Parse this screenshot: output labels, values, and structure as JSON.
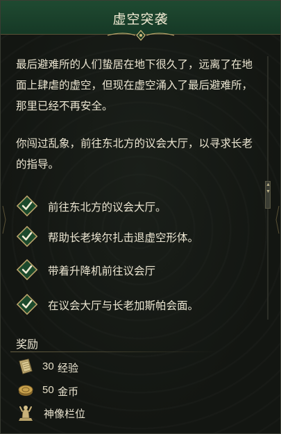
{
  "quest": {
    "title": "虚空突袭",
    "description": [
      "最后避难所的人们蛰居在地下很久了，远离了在地面上肆虐的虚空，但现在虚空涌入了最后避难所，那里已经不再安全。",
      "你闯过乱象，前往东北方的议会大厅，以寻求长老的指导。"
    ],
    "objectives": [
      {
        "label": "前往东北方的议会大厅。",
        "completed": true
      },
      {
        "label": "帮助长老埃尔扎击退虚空形体。",
        "completed": true
      },
      {
        "label": "带着升降机前往议会厅",
        "completed": true
      },
      {
        "label": "在议会大厅与长老加斯帕会面。",
        "completed": true
      }
    ]
  },
  "rewards": {
    "title": "奖励",
    "items": [
      {
        "icon": "experience-book-icon",
        "amount": "30",
        "label": "经验"
      },
      {
        "icon": "gold-coin-icon",
        "amount": "50",
        "label": "金币"
      },
      {
        "icon": "statue-slot-icon",
        "amount": "",
        "label": "神像栏位"
      }
    ]
  },
  "colors": {
    "header": "#1f4a31",
    "check_bg": "#1c4a2c",
    "check_border": "#b9a36a",
    "check_mark": "#f4eed8",
    "text": "#ece6d2"
  }
}
